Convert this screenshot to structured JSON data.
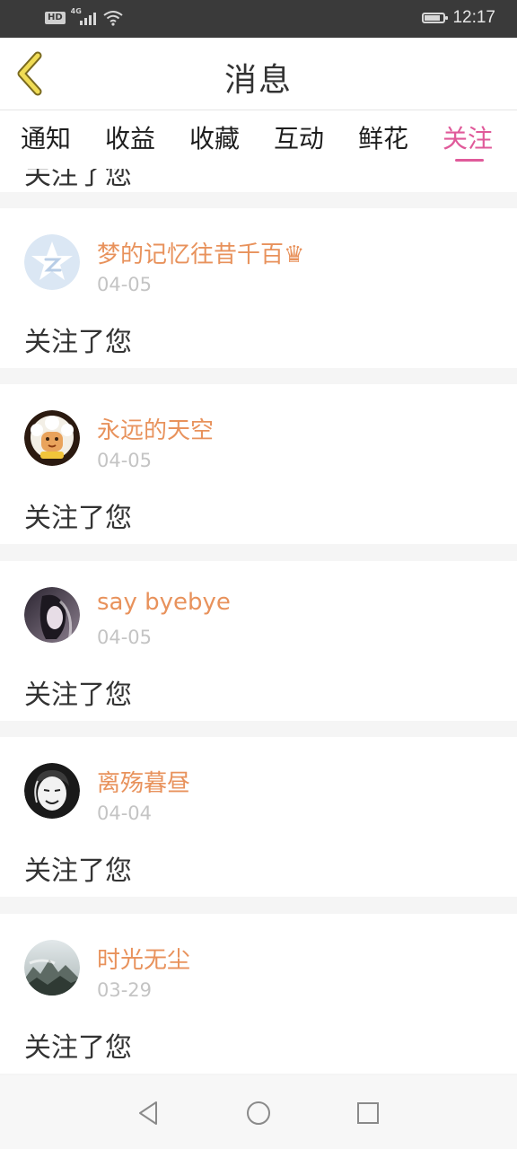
{
  "status_bar": {
    "badge": "HD",
    "network": "4G",
    "time": "12:17"
  },
  "header": {
    "title": "消息"
  },
  "tabs": [
    {
      "label": "通知"
    },
    {
      "label": "收益"
    },
    {
      "label": "收藏"
    },
    {
      "label": "互动"
    },
    {
      "label": "鲜花"
    },
    {
      "label": "关注",
      "active": true
    }
  ],
  "partial_item": {
    "message": "关注了您"
  },
  "items": [
    {
      "name": "梦的记忆往昔千百♛",
      "date": "04-05",
      "message": "关注了您",
      "avatar": "default-avatar-icon"
    },
    {
      "name": "永远的天空",
      "date": "04-05",
      "message": "关注了您",
      "avatar": "cartoon-avatar"
    },
    {
      "name": "say byebye",
      "date": "04-05",
      "message": "关注了您",
      "avatar": "photo-avatar"
    },
    {
      "name": "离殇暮昼",
      "date": "04-04",
      "message": "关注了您",
      "avatar": "sketch-avatar"
    },
    {
      "name": "时光无尘",
      "date": "03-29",
      "message": "关注了您",
      "avatar": "landscape-avatar"
    }
  ],
  "colors": {
    "accent": "#e05a9a",
    "username": "#e8925c",
    "back_icon": "#e8d04a"
  }
}
